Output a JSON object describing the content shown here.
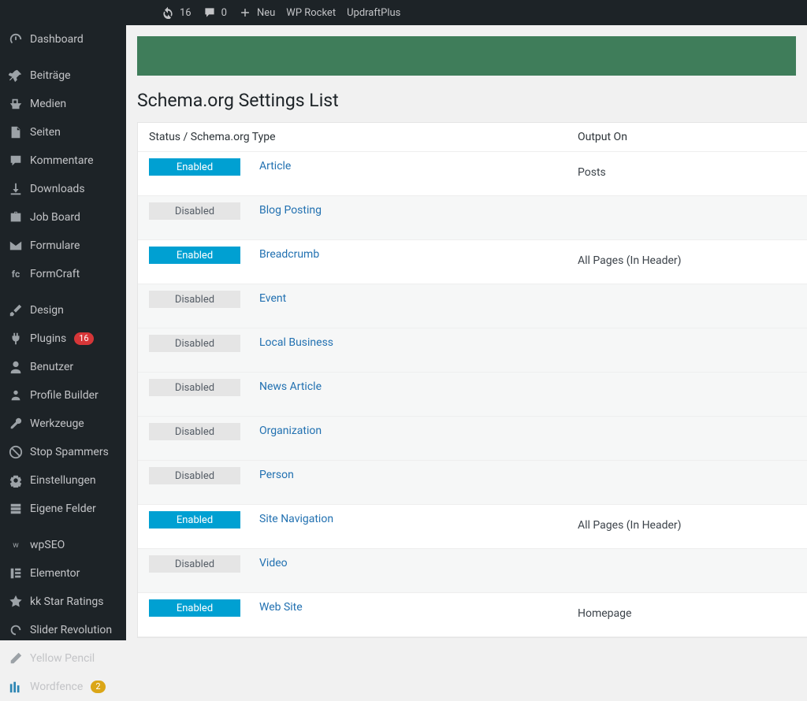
{
  "adminbar": {
    "updates_count": "16",
    "comments_count": "0",
    "new_label": "Neu",
    "items": [
      "WP Rocket",
      "UpdraftPlus"
    ]
  },
  "sidebar": {
    "items": [
      {
        "icon": "dashboard",
        "label": "Dashboard"
      },
      {
        "sep": true
      },
      {
        "icon": "pin",
        "label": "Beiträge"
      },
      {
        "icon": "media",
        "label": "Medien"
      },
      {
        "icon": "page",
        "label": "Seiten"
      },
      {
        "icon": "comment",
        "label": "Kommentare"
      },
      {
        "icon": "download",
        "label": "Downloads"
      },
      {
        "icon": "briefcase",
        "label": "Job Board"
      },
      {
        "icon": "mail",
        "label": "Formulare"
      },
      {
        "icon": "fc",
        "label": "FormCraft"
      },
      {
        "sep": true
      },
      {
        "icon": "brush",
        "label": "Design"
      },
      {
        "icon": "plugin",
        "label": "Plugins",
        "badge": "16",
        "badgeClass": ""
      },
      {
        "icon": "user",
        "label": "Benutzer"
      },
      {
        "icon": "profile",
        "label": "Profile Builder"
      },
      {
        "icon": "wrench",
        "label": "Werkzeuge"
      },
      {
        "icon": "stop",
        "label": "Stop Spammers"
      },
      {
        "icon": "settings",
        "label": "Einstellungen"
      },
      {
        "icon": "fields",
        "label": "Eigene Felder"
      },
      {
        "sep": true
      },
      {
        "icon": "seo",
        "label": "wpSEO"
      },
      {
        "icon": "elementor",
        "label": "Elementor"
      },
      {
        "icon": "star",
        "label": "kk Star Ratings",
        "star": true
      },
      {
        "icon": "revolve",
        "label": "Slider Revolution"
      },
      {
        "icon": "pencil",
        "label": "Yellow Pencil"
      },
      {
        "icon": "wordfence",
        "label": "Wordfence",
        "badge": "2",
        "badgeClass": "orange"
      }
    ]
  },
  "page": {
    "title": "Schema.org Settings List",
    "col1": "Status  /  Schema.org Type",
    "col2": "Output On"
  },
  "rows": [
    {
      "status": "Enabled",
      "type": "Article",
      "output": "Posts"
    },
    {
      "status": "Disabled",
      "type": "Blog Posting",
      "output": ""
    },
    {
      "status": "Enabled",
      "type": "Breadcrumb",
      "output": "All Pages (In Header)"
    },
    {
      "status": "Disabled",
      "type": "Event",
      "output": ""
    },
    {
      "status": "Disabled",
      "type": "Local Business",
      "output": ""
    },
    {
      "status": "Disabled",
      "type": "News Article",
      "output": ""
    },
    {
      "status": "Disabled",
      "type": "Organization",
      "output": ""
    },
    {
      "status": "Disabled",
      "type": "Person",
      "output": ""
    },
    {
      "status": "Enabled",
      "type": "Site Navigation",
      "output": "All Pages (In Header)"
    },
    {
      "status": "Disabled",
      "type": "Video",
      "output": ""
    },
    {
      "status": "Enabled",
      "type": "Web Site",
      "output": "Homepage"
    }
  ],
  "status_labels": {
    "Enabled": "Enabled",
    "Disabled": "Disabled"
  }
}
